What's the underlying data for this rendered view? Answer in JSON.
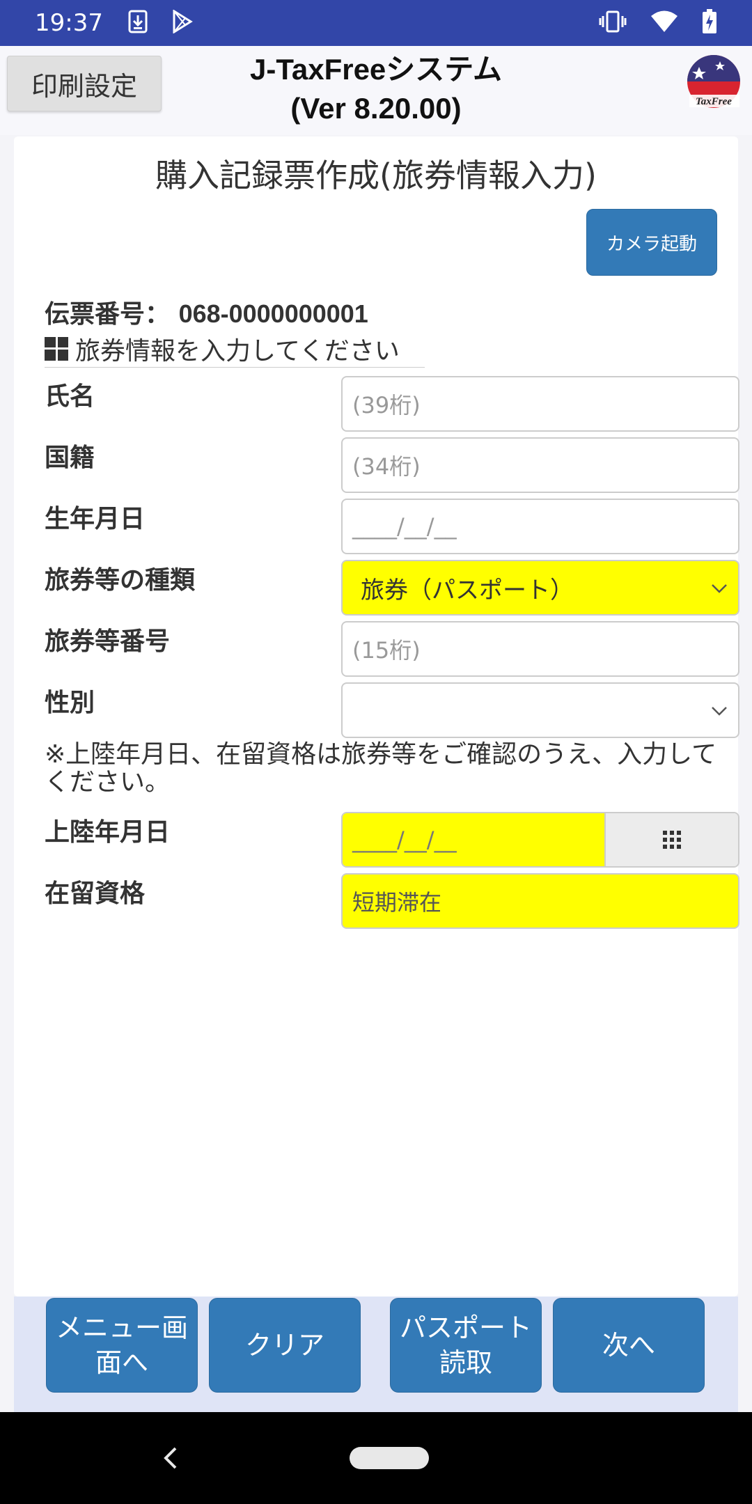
{
  "status_bar": {
    "time": "19:37",
    "icons_left": [
      "download-icon",
      "play-store-icon"
    ],
    "icons_right": [
      "vibrate-icon",
      "wifi-icon",
      "battery-charging-icon"
    ]
  },
  "header": {
    "print_settings_label": "印刷設定",
    "title_line1": "J-TaxFreeシステム",
    "title_line2": "(Ver 8.20.00)",
    "logo_text": "TaxFree"
  },
  "screen": {
    "title": "購入記録票作成(旅券情報入力)",
    "camera_button": "カメラ起動",
    "slip_label": "伝票番号：",
    "slip_number": "068-0000000001",
    "section_heading": "旅券情報を入力してください"
  },
  "form": {
    "name": {
      "label": "氏名",
      "placeholder": "(39桁)"
    },
    "nationality": {
      "label": "国籍",
      "placeholder": "(34桁)"
    },
    "birthdate": {
      "label": "生年月日",
      "placeholder": "____/__/__"
    },
    "passport_type": {
      "label": "旅券等の種類",
      "value": "旅券（パスポート）"
    },
    "passport_number": {
      "label": "旅券等番号",
      "placeholder": "(15桁)"
    },
    "gender": {
      "label": "性別",
      "value": ""
    },
    "note": "※上陸年月日、在留資格は旅券等をご確認のうえ、入力してください。",
    "landing_date": {
      "label": "上陸年月日",
      "placeholder": "____/__/__"
    },
    "residence_status": {
      "label": "在留資格",
      "value": "短期滞在"
    }
  },
  "bottom_buttons": {
    "menu": "メニュー画\n面へ",
    "clear": "クリア",
    "passport_read": "パスポート\n読取",
    "next": "次へ"
  },
  "colors": {
    "status_bar": "#3246a8",
    "button_blue": "#337ab7",
    "highlight_yellow": "#ffff00"
  }
}
